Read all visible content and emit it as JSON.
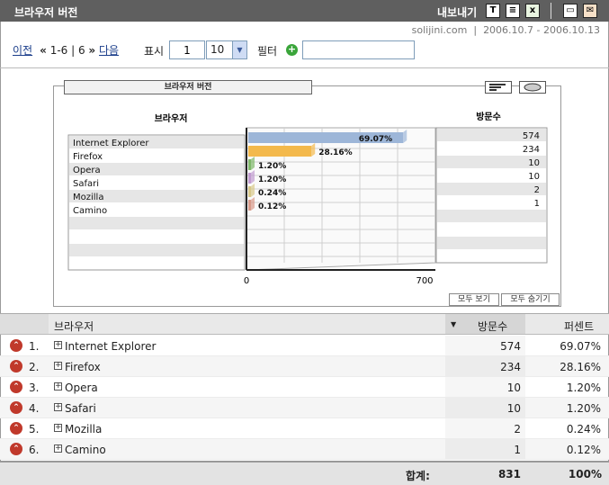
{
  "header": {
    "title": "브라우저 버전",
    "export_label": "내보내기",
    "icons": [
      "text-export-icon",
      "document-export-icon",
      "excel-export-icon",
      "print-icon",
      "email-icon"
    ],
    "site": "solijini.com",
    "date_range": "2006.10.7 - 2006.10.13"
  },
  "pager": {
    "prev": "이전",
    "range": "1-6 | 6",
    "next": "다음",
    "show_label": "표시",
    "start_value": "1",
    "page_size": "10",
    "filter_label": "필터",
    "filter_value": ""
  },
  "chart_data": {
    "type": "bar",
    "title": "브라우저 버전",
    "xlabel": "브라우저",
    "ylabel": "방문수",
    "categories": [
      "Internet Explorer",
      "Firefox",
      "Opera",
      "Safari",
      "Mozilla",
      "Camino"
    ],
    "values": [
      574,
      234,
      10,
      10,
      2,
      1
    ],
    "percent_labels": [
      "69.07%",
      "28.16%",
      "1.20%",
      "1.20%",
      "0.24%",
      "0.12%"
    ],
    "colors": [
      "#9db6d8",
      "#f3b94c",
      "#7fb86a",
      "#c19bd0",
      "#d8c98a",
      "#d89a8a"
    ],
    "xlim": [
      0,
      700
    ],
    "x_tick_labels": [
      "0",
      "700"
    ],
    "orientation": "horizontal",
    "grid": true,
    "buttons": {
      "show_all": "모두 보기",
      "hide_all": "모두 숨기기"
    }
  },
  "table": {
    "columns": {
      "browser": "브라우저",
      "visits": "방문수",
      "percent": "퍼센트"
    },
    "rows": [
      {
        "rank": "1.",
        "name": "Internet Explorer",
        "visits": "574",
        "percent": "69.07%"
      },
      {
        "rank": "2.",
        "name": "Firefox",
        "visits": "234",
        "percent": "28.16%"
      },
      {
        "rank": "3.",
        "name": "Opera",
        "visits": "10",
        "percent": "1.20%"
      },
      {
        "rank": "4.",
        "name": "Safari",
        "visits": "10",
        "percent": "1.20%"
      },
      {
        "rank": "5.",
        "name": "Mozilla",
        "visits": "2",
        "percent": "0.24%"
      },
      {
        "rank": "6.",
        "name": "Camino",
        "visits": "1",
        "percent": "0.12%"
      }
    ],
    "total_label": "합계:",
    "total_visits": "831",
    "total_percent": "100%"
  }
}
